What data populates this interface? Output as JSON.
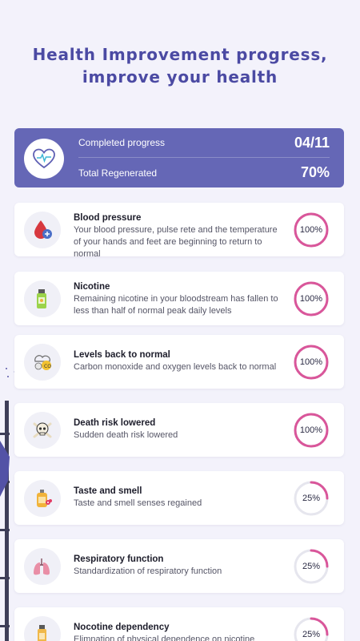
{
  "header": {
    "line1": "Health Improvement progress,",
    "line2": "improve your health"
  },
  "summary": {
    "completed_label": "Completed progress",
    "completed_value": "04/11",
    "regenerated_label": "Total Regenerated",
    "regenerated_value": "70%",
    "icon": "heart-pulse-icon"
  },
  "colors": {
    "accent": "#6567b6",
    "ring": "#d9569a",
    "ring_track": "#e6e6ee",
    "background": "#f3f2fb"
  },
  "milestones": [
    {
      "title": "Blood pressure",
      "description": "Your blood pressure, pulse rete and the temperature of your hands and feet are beginning to return to normal",
      "percent_label": "100%",
      "progress": 1.0,
      "icon": "blood-drop-icon"
    },
    {
      "title": "Nicotine",
      "description": "Remaining nicotine in your bloodstream has fallen to less than half of normal peak daily levels",
      "percent_label": "100%",
      "progress": 1.0,
      "icon": "nicotine-bottle-icon"
    },
    {
      "title": "Levels back to normal",
      "description": "Carbon monoxide and oxygen levels back to normal",
      "percent_label": "100%",
      "progress": 1.0,
      "icon": "co2-cloud-icon"
    },
    {
      "title": "Death risk lowered",
      "description": "Sudden death risk lowered",
      "percent_label": "100%",
      "progress": 1.0,
      "icon": "skull-crossbones-icon"
    },
    {
      "title": "Taste and smell",
      "description": "Taste and smell senses regained",
      "percent_label": "25%",
      "progress": 0.25,
      "icon": "perfume-flower-icon"
    },
    {
      "title": "Respiratory function",
      "description": "Standardization of respiratory function",
      "percent_label": "25%",
      "progress": 0.25,
      "icon": "lungs-icon"
    },
    {
      "title": "Nocotine dependency",
      "description": "Elimnation of physical dependence on nicotine",
      "percent_label": "25%",
      "progress": 0.25,
      "icon": "nicotine-vial-icon"
    }
  ]
}
